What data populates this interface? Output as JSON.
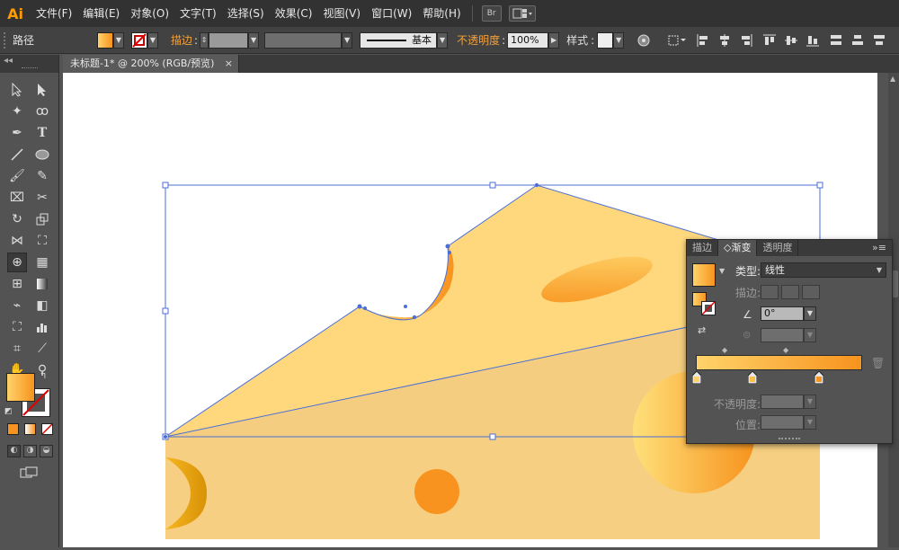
{
  "app": {
    "logo": "Ai",
    "menu": [
      "文件(F)",
      "编辑(E)",
      "对象(O)",
      "文字(T)",
      "选择(S)",
      "效果(C)",
      "视图(V)",
      "窗口(W)",
      "帮助(H)"
    ],
    "bridge_label": "Br",
    "workspace_icon": "arrange-documents-icon"
  },
  "control_bar": {
    "selection_type": "路径",
    "stroke_label": "描边",
    "stroke_style": "基本",
    "opacity_label": "不透明度",
    "opacity_value": "100%",
    "style_label": "样式"
  },
  "document_tab": {
    "title": "未标题-1* @ 200% (RGB/预览)",
    "close": "×"
  },
  "gradient_panel": {
    "tabs": [
      "描边",
      "◇渐变",
      "透明度"
    ],
    "active_tab": 1,
    "type_label": "类型",
    "type_value": "线性",
    "stroke_label": "描边",
    "angle_value": "0°",
    "opacity_label": "不透明度",
    "position_label": "位置",
    "menu_icon": "»≡",
    "colors": {
      "start": "#ffd36a",
      "end": "#f7931e"
    }
  },
  "colors": {
    "fill_gradient_start": "#ffd36a",
    "fill_gradient_end": "#f7931e",
    "cheese_top": "#ffd87e",
    "cheese_side": "#f6cf82",
    "selection": "#4b6fd6",
    "accent_orange": "#ff9a00"
  }
}
